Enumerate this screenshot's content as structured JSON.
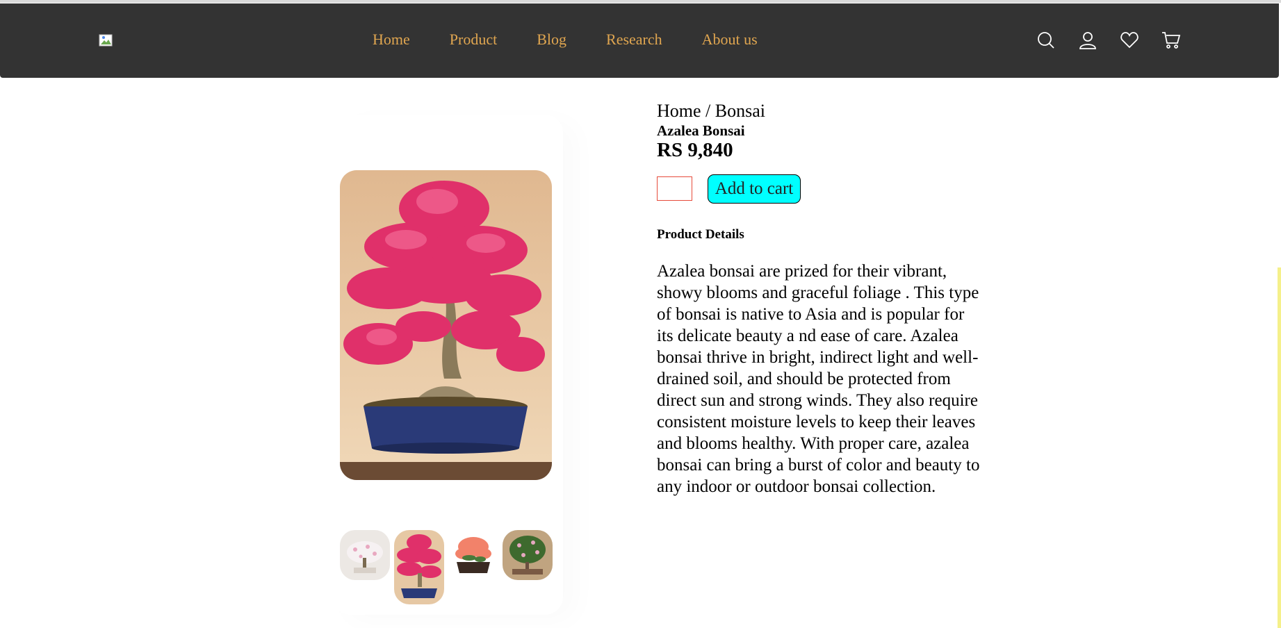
{
  "nav": {
    "links": [
      "Home",
      "Product",
      "Blog",
      "Research",
      "About us"
    ],
    "icons": [
      "search-icon",
      "user-icon",
      "heart-icon",
      "cart-icon"
    ]
  },
  "product": {
    "breadcrumb": "Home / Bonsai",
    "name": "Azalea Bonsai",
    "price": "RS 9,840",
    "add_to_cart_label": "Add to cart",
    "details_heading": "Product Details",
    "description": "Azalea bonsai are prized for their vibrant, showy blooms and graceful foliage . This type of bonsai is native to Asia and is popular for its delicate beauty a nd ease of care. Azalea bonsai thrive in bright, indirect light and well-drained soil, and should be protected from direct sun and strong winds. They also require consistent moisture levels to keep their leaves and blooms healthy. With proper care, azalea bonsai can bring a burst of color and beauty to any indoor or outdoor bonsai collection."
  },
  "colors": {
    "navbar": "#333333",
    "nav_link": "#e0a650",
    "button": "#00ffff",
    "qty_border": "#e64a3a"
  }
}
